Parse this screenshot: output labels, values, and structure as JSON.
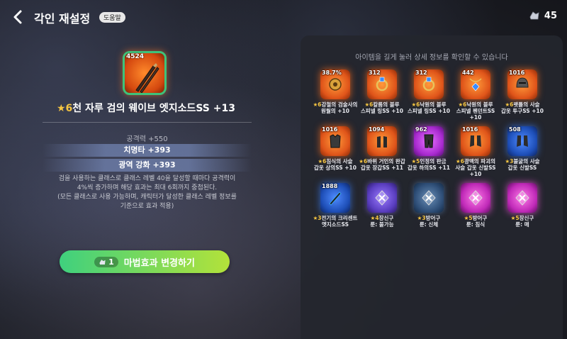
{
  "header": {
    "title": "각인 재설정",
    "help_label": "도움말",
    "currency_amount": "45",
    "currency_icon": "crystal-icon"
  },
  "selected_item": {
    "level": "4524",
    "star": "★6",
    "name": "천 자루 검의 웨이브 엣지소드SS +13",
    "stat_plain": "공격력 +550",
    "stat_highlight_1": "치명타 +393",
    "stat_highlight_2": "광역 강화 +393",
    "desc_1": "검을 사용하는 클래스로 클래스 레벨 40을 달성할 때마다 공격력이",
    "desc_2": "4%씩 증가하며 해당 효과는 최대 6회까지 중첩된다.",
    "desc_3": "(모든 클래스로 사용 가능하며, 캐릭터가 달성한 클래스 레벨 정보를",
    "desc_4": "기준으로 효과 적용)",
    "accent_color": "#3ec27a"
  },
  "change_button": {
    "cost": "1",
    "label": "마법효과 변경하기"
  },
  "inventory": {
    "hint": "아이템을 길게 눌러 상세 정보를 확인할 수 있습니다",
    "items": [
      {
        "lvl": "38.7%",
        "star": "★6",
        "name": "강철의 검술사의\n원월의 +10",
        "color": "orange",
        "icon": "gear-icon"
      },
      {
        "lvl": "312",
        "star": "★6",
        "name": "칼룸의 블루\n스피넬 링SS +10",
        "color": "orange",
        "icon": "ring-icon"
      },
      {
        "lvl": "312",
        "star": "★6",
        "name": "낙원의 블루\n스피넬 링SS +10",
        "color": "orange",
        "icon": "ring-icon"
      },
      {
        "lvl": "442",
        "star": "★6",
        "name": "낙원의 블루\n스피넬 펜던트SS +10",
        "color": "orange",
        "icon": "pendant-icon"
      },
      {
        "lvl": "1016",
        "star": "★6",
        "name": "랫틀의 사슬\n갑옷 투구SS +10",
        "color": "orange",
        "icon": "helmet-icon"
      },
      {
        "lvl": "1016",
        "star": "★6",
        "name": "침식의 사슬\n갑옷 상의SS +10",
        "color": "orange",
        "icon": "armor-icon"
      },
      {
        "lvl": "1094",
        "star": "★6",
        "name": "바위 거인의 완갑\n갑옷 장갑SS +11",
        "color": "orange",
        "icon": "gloves-icon"
      },
      {
        "lvl": "962",
        "star": "★5",
        "name": "인정의 판금\n갑옷 하의SS +11",
        "color": "magenta",
        "icon": "pants-icon"
      },
      {
        "lvl": "1016",
        "star": "★6",
        "name": "광맥의 파괴의\n사슬 갑옷 신발SS +10",
        "color": "orange",
        "icon": "boots-icon"
      },
      {
        "lvl": "508",
        "star": "★3",
        "name": "불굴의 사슬\n갑옷 신발SS",
        "color": "blue",
        "icon": "boots-icon"
      },
      {
        "lvl": "1888",
        "star": "★3",
        "name": "전기의 크리센트\n엣지소드SS",
        "color": "blue",
        "icon": "sword-icon"
      },
      {
        "lvl": "",
        "star": "★4",
        "name": "장신구\n룬: 불가능",
        "color": "purple",
        "icon": "rune-icon"
      },
      {
        "lvl": "",
        "star": "★3",
        "name": "방어구\n룬: 신체",
        "color": "slate",
        "icon": "rune-icon"
      },
      {
        "lvl": "",
        "star": "★5",
        "name": "방어구\n룬: 침식",
        "color": "pink",
        "icon": "rune-icon"
      },
      {
        "lvl": "",
        "star": "★5",
        "name": "장신구\n룬: 매",
        "color": "pink",
        "icon": "rune-icon"
      }
    ]
  }
}
